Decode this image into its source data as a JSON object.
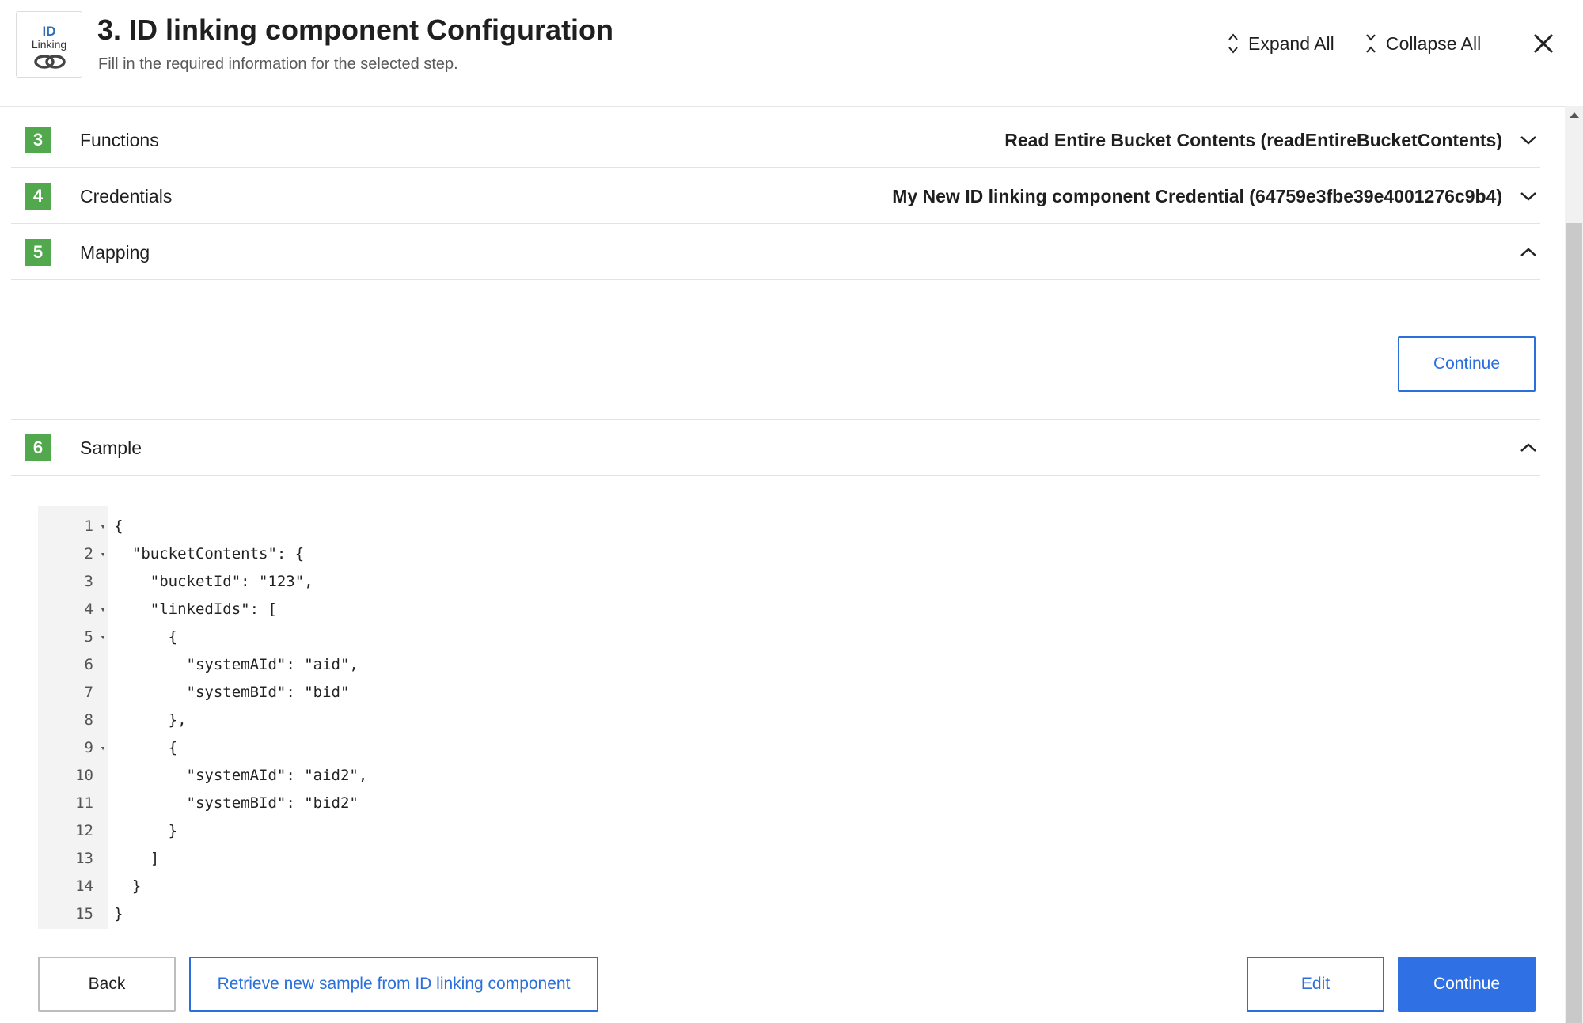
{
  "header": {
    "logo_line1": "ID",
    "logo_line2": "Linking",
    "title": "3. ID linking component Configuration",
    "subtitle": "Fill in the required information for the selected step.",
    "expand_all": "Expand All",
    "collapse_all": "Collapse All"
  },
  "sections": [
    {
      "number": "3",
      "label": "Functions",
      "value": "Read Entire Bucket Contents (readEntireBucketContents)",
      "expanded": false
    },
    {
      "number": "4",
      "label": "Credentials",
      "value": "My New ID linking component Credential (64759e3fbe39e4001276c9b4)",
      "expanded": false
    },
    {
      "number": "5",
      "label": "Mapping",
      "value": "",
      "expanded": true
    },
    {
      "number": "6",
      "label": "Sample",
      "value": "",
      "expanded": true
    }
  ],
  "mapping": {
    "continue_label": "Continue"
  },
  "sample": {
    "lines": [
      {
        "n": "1",
        "fold": true,
        "text": "{"
      },
      {
        "n": "2",
        "fold": true,
        "text": "  \"bucketContents\": {"
      },
      {
        "n": "3",
        "fold": false,
        "text": "    \"bucketId\": \"123\","
      },
      {
        "n": "4",
        "fold": true,
        "text": "    \"linkedIds\": ["
      },
      {
        "n": "5",
        "fold": true,
        "text": "      {"
      },
      {
        "n": "6",
        "fold": false,
        "text": "        \"systemAId\": \"aid\","
      },
      {
        "n": "7",
        "fold": false,
        "text": "        \"systemBId\": \"bid\""
      },
      {
        "n": "8",
        "fold": false,
        "text": "      },"
      },
      {
        "n": "9",
        "fold": true,
        "text": "      {"
      },
      {
        "n": "10",
        "fold": false,
        "text": "        \"systemAId\": \"aid2\","
      },
      {
        "n": "11",
        "fold": false,
        "text": "        \"systemBId\": \"bid2\""
      },
      {
        "n": "12",
        "fold": false,
        "text": "      }"
      },
      {
        "n": "13",
        "fold": false,
        "text": "    ]"
      },
      {
        "n": "14",
        "fold": false,
        "text": "  }"
      },
      {
        "n": "15",
        "fold": false,
        "text": "}"
      }
    ]
  },
  "footer": {
    "back_label": "Back",
    "retrieve_label": "Retrieve new sample from ID linking component",
    "edit_label": "Edit",
    "continue_label": "Continue"
  },
  "colors": {
    "accent": "#2f70e4",
    "badge": "#52a84d",
    "logo_text": "#2f6db4"
  },
  "icons": {
    "expand": "expand-vertical-icon",
    "collapse": "collapse-vertical-icon",
    "close": "close-icon",
    "chevron_down": "chevron-down-icon",
    "chevron_up": "chevron-up-icon",
    "fold": "fold-triangle-icon"
  }
}
